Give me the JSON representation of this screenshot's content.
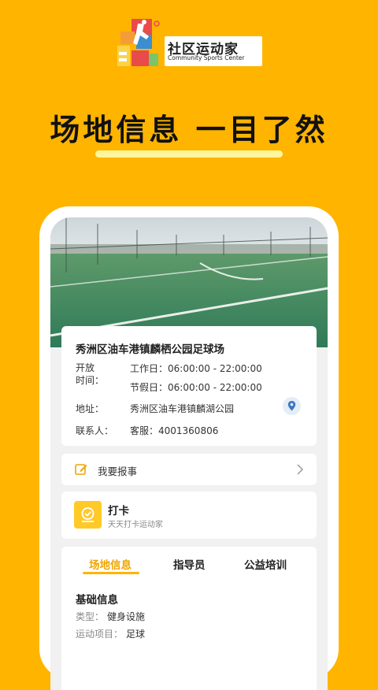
{
  "brand": {
    "name_cn": "社区运动家",
    "name_en": "Community Sports Center"
  },
  "headline": "场地信息  一目了然",
  "venue": {
    "name": "秀洲区油车港镇麟栖公园足球场",
    "open_label": "开放\n时间",
    "open_label_1": "开放",
    "open_label_2": "时间：",
    "workday": "工作日：06:00:00 - 22:00:00",
    "holiday": "节假日：06:00:00 - 22:00:00",
    "address_label": "地址：",
    "address": "秀洲区油车港镇麟湖公园",
    "contact_label": "联系人：",
    "contact": "客服：4001360806"
  },
  "report": {
    "label": "我要报事"
  },
  "checkin": {
    "title": "打卡",
    "subtitle": "天天打卡运动家"
  },
  "tabs": [
    {
      "label": "场地信息",
      "active": true
    },
    {
      "label": "指导员",
      "active": false
    },
    {
      "label": "公益培训",
      "active": false
    }
  ],
  "basic_info": {
    "title": "基础信息",
    "type_label": "类型：",
    "type_value": "健身设施",
    "sport_label": "运动项目：",
    "sport_value": "足球"
  },
  "colors": {
    "background": "#FFB400",
    "accent": "#F0A500",
    "highlight_bar": "#FFF59A"
  }
}
